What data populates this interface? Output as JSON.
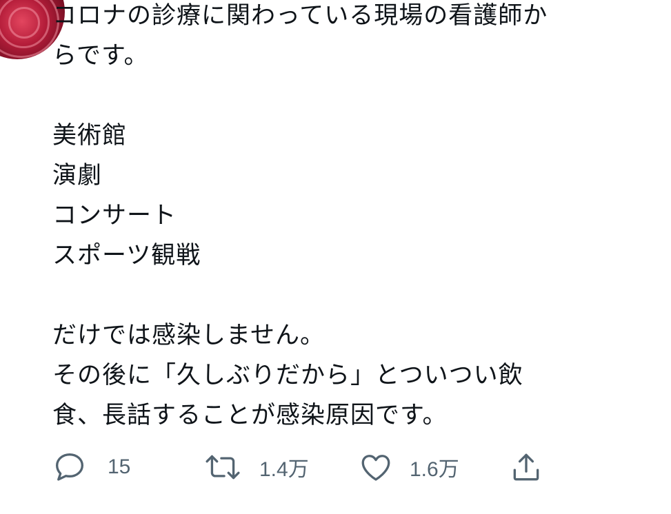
{
  "tweet": {
    "lines": [
      "コロナの診療に関わっている現場の看護師か",
      "らです。",
      "",
      "美術館",
      "演劇",
      "コンサート",
      "スポーツ観戦",
      "",
      "だけでは感染しません。",
      "その後に「久しぶりだから」とついつい飲",
      "食、長話することが感染原因です。"
    ]
  },
  "actions": {
    "reply_count": "15",
    "retweet_count": "1.4万",
    "like_count": "1.6万"
  },
  "icons": {
    "reply": "reply-icon",
    "retweet": "retweet-icon",
    "like": "heart-icon",
    "share": "share-icon"
  },
  "colors": {
    "text": "#0f1419",
    "icon": "#536471",
    "avatar": "#b51d3a"
  }
}
